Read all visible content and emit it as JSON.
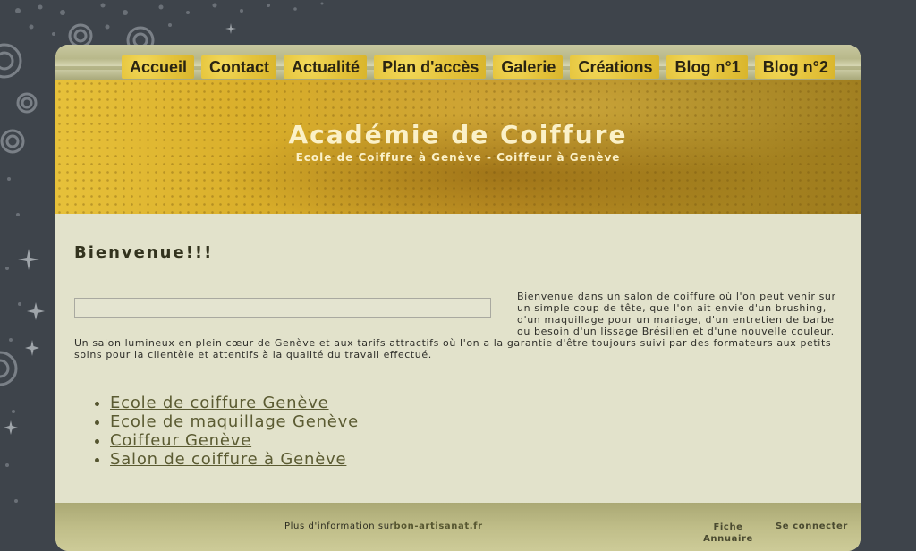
{
  "nav": {
    "items": [
      {
        "label": "Accueil"
      },
      {
        "label": "Contact"
      },
      {
        "label": "Actualité"
      },
      {
        "label": "Plan d'accès"
      },
      {
        "label": "Galerie"
      },
      {
        "label": "Créations"
      },
      {
        "label": "Blog n°1"
      },
      {
        "label": "Blog n°2"
      }
    ]
  },
  "banner": {
    "title": "Académie de Coiffure",
    "subtitle": "Ecole de Coiffure à Genève - Coiffeur à Genève"
  },
  "main": {
    "heading": "Bienvenue!!!",
    "intro": "Bienvenue dans un salon de coiffure où l'on peut venir sur un simple coup de tête, que l'on ait envie d'un brushing, d'un maquillage pour un mariage, d'un entretien de barbe ou besoin d'un lissage Brésilien et d'une nouvelle couleur. Un salon lumineux en plein cœur de Genève et aux tarifs attractifs où l'on a la garantie d'être toujours suivi par des formateurs aux petits soins pour la clientèle et attentifs à la qualité du travail effectué.",
    "links": [
      {
        "label": "Ecole de coiffure Genève"
      },
      {
        "label": "Ecole de maquillage Genève"
      },
      {
        "label": "Coiffeur Genève"
      },
      {
        "label": "Salon de coiffure à Genève"
      }
    ]
  },
  "footer": {
    "info_prefix": "Plus d'information sur",
    "info_link": "bon-artisanat.fr",
    "fiche_label": "Fiche Annuaire",
    "login_label": "Se connecter"
  },
  "colors": {
    "background": "#3e444b",
    "page": "#e2e2cb",
    "nav_tab": "#e5c43c",
    "banner_text": "#fbf1c8"
  }
}
